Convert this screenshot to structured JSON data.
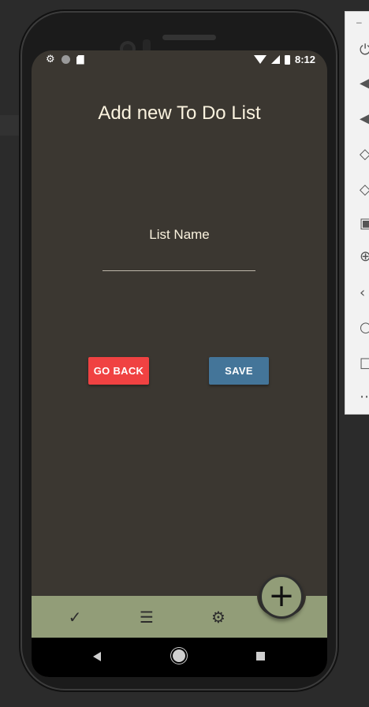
{
  "status_bar": {
    "time": "8:12",
    "icons": [
      "settings-icon",
      "circle-icon",
      "sd-card-icon",
      "wifi-icon",
      "signal-icon",
      "battery-icon"
    ]
  },
  "screen": {
    "title": "Add new To Do List",
    "field_label": "List Name",
    "field_value": "",
    "buttons": {
      "go_back": "GO BACK",
      "save": "SAVE"
    }
  },
  "bottom_nav": {
    "tabs": [
      {
        "name": "check",
        "icon": "✓"
      },
      {
        "name": "list",
        "icon": "☰"
      },
      {
        "name": "settings",
        "icon": "⚙"
      }
    ],
    "fab_icon": "+"
  },
  "colors": {
    "screen_bg": "#3b3731",
    "title_text": "#fbf3df",
    "go_back_button": "#f04242",
    "save_button": "#447599",
    "bottom_bar": "#929d78"
  },
  "emulator_toolbar": {
    "icons": [
      "power-icon",
      "volume-up-icon",
      "volume-down-icon",
      "rotate-left-icon",
      "rotate-right-icon",
      "camera-icon",
      "zoom-icon",
      "back-icon",
      "home-icon",
      "overview-icon",
      "more-icon"
    ]
  }
}
